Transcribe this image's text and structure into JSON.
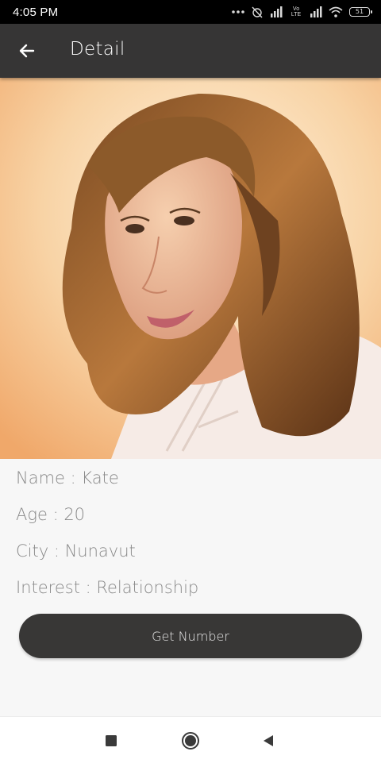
{
  "status_bar": {
    "time": "4:05 PM",
    "network_label": "Vo LTE",
    "battery": "51"
  },
  "app_bar": {
    "title": "Detail",
    "back_icon": "arrow-left-icon"
  },
  "profile": {
    "photo_icon": "profile-photo",
    "name_label": "Name : Kate",
    "age_label": "Age : 20",
    "city_label": "City : Nunavut",
    "interest_label": "Interest : Relationship"
  },
  "actions": {
    "get_number_label": "Get Number"
  },
  "nav_bar": {
    "recents_icon": "square-icon",
    "home_icon": "circle-icon",
    "back_icon": "triangle-back-icon"
  },
  "colors": {
    "app_bar": "#363535",
    "button": "#383736",
    "text_muted": "#8a8a8a",
    "background": "#f7f7f7"
  }
}
